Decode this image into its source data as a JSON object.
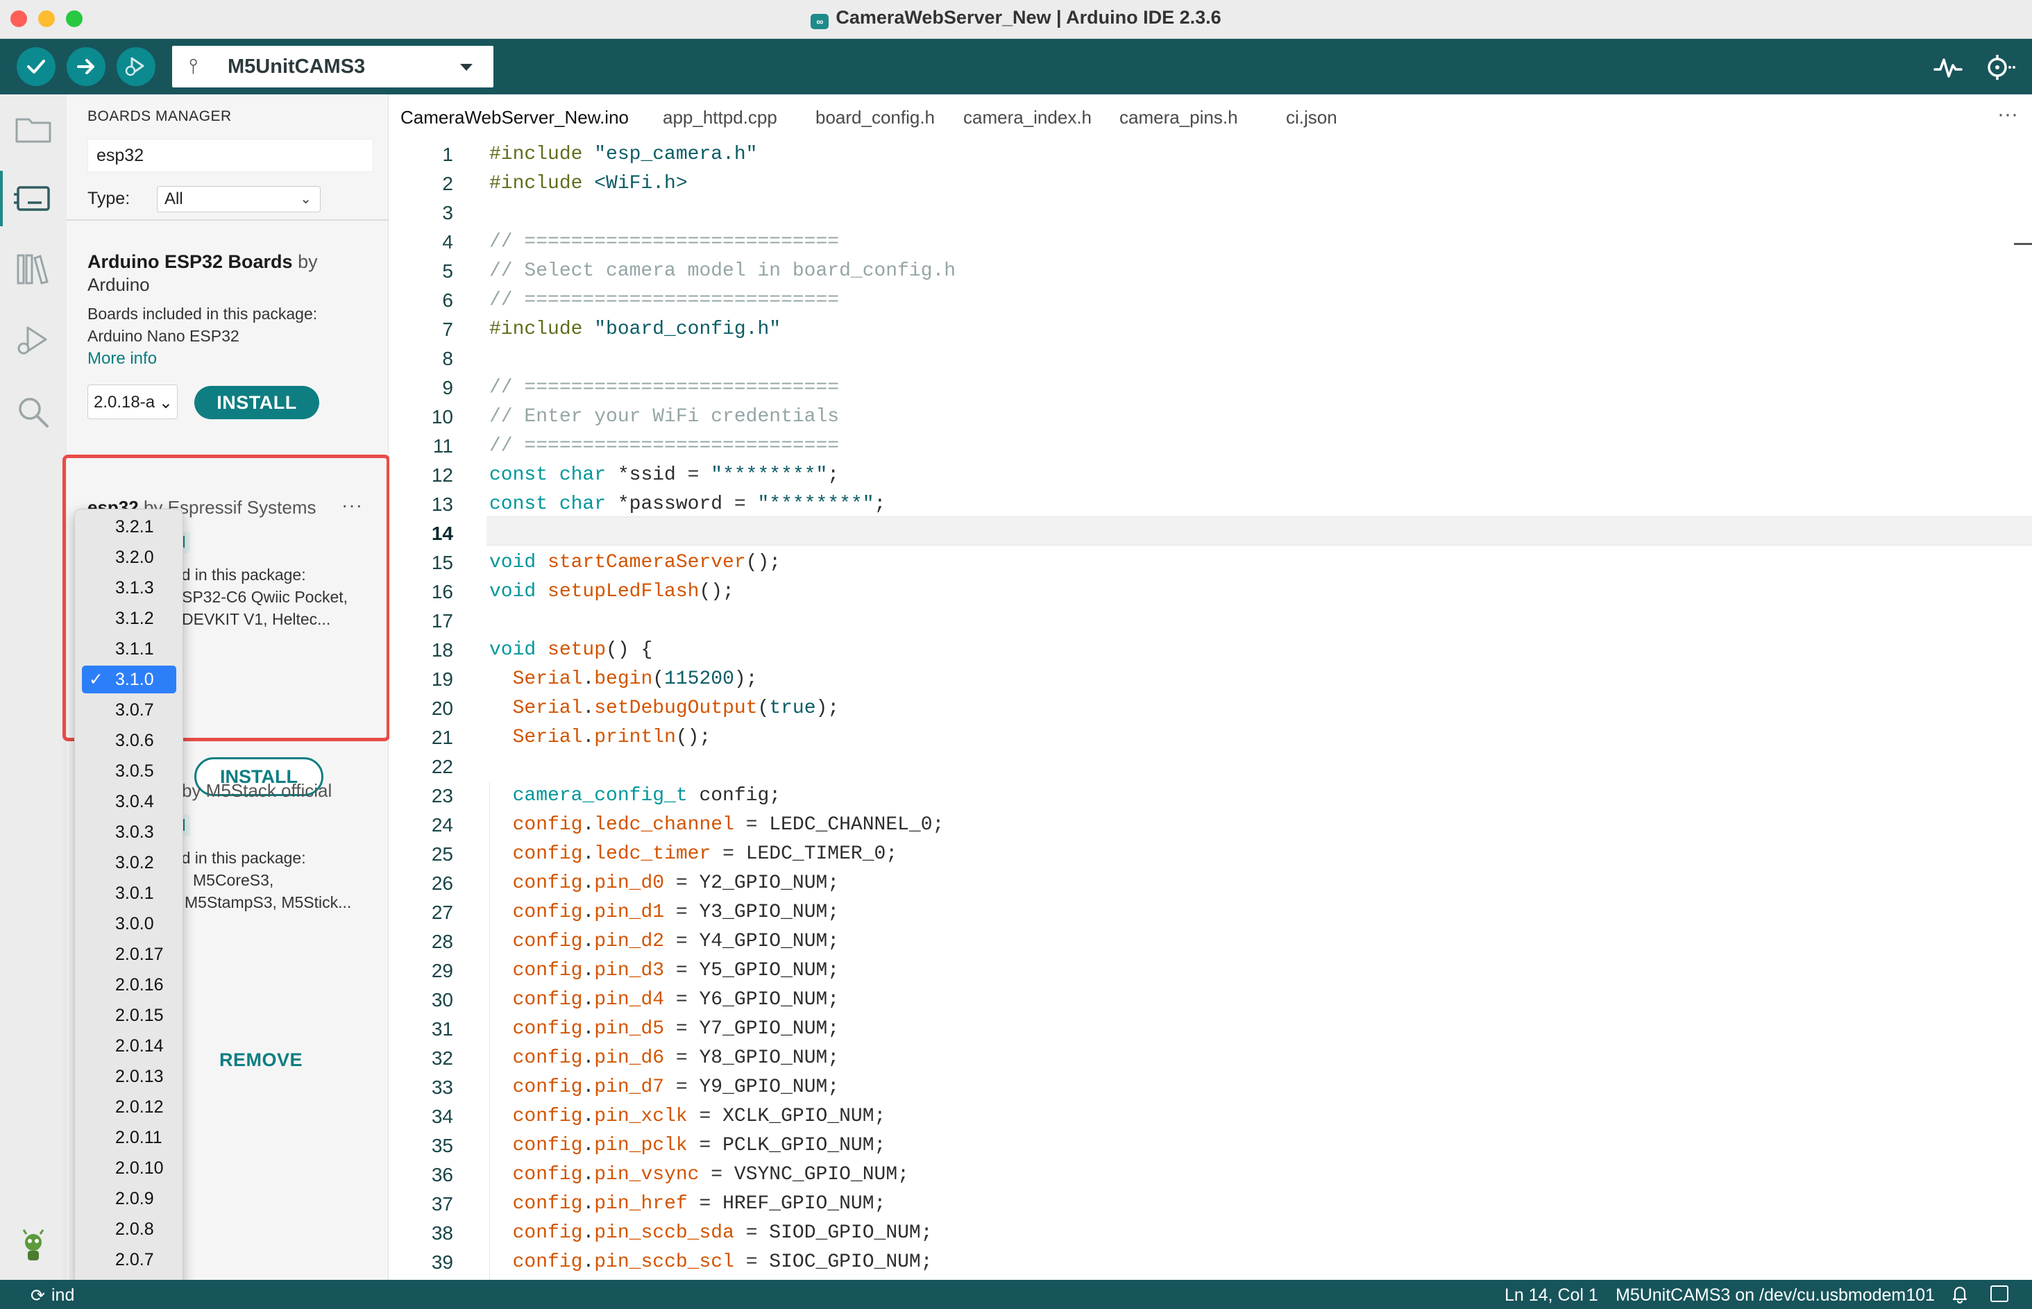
{
  "window": {
    "title": "CameraWebServer_New | Arduino IDE 2.3.6"
  },
  "toolbar": {
    "board": "M5UnitCAMS3",
    "verify_icon": "check-icon",
    "upload_icon": "arrow-right-icon",
    "debug_icon": "debug-icon"
  },
  "boards_manager": {
    "title": "BOARDS MANAGER",
    "search_value": "esp32",
    "type_label": "Type:",
    "type_value": "All",
    "packages": [
      {
        "name": "Arduino ESP32 Boards",
        "by": "by",
        "author": "Arduino",
        "included_label": "Boards included in this package:",
        "boards": "Arduino Nano ESP32",
        "more_info": "More info",
        "version": "2.0.18-a",
        "action": "INSTALL"
      },
      {
        "name": "esp32",
        "by_author": "by Espressif Systems",
        "installed": "ed",
        "included_fragment": "ded in this package:",
        "boards_line1": "SP32-C6 Qwiic Pocket,",
        "boards_line2": "DEVKIT V1, Heltec...",
        "action": "INSTALL"
      },
      {
        "by_author": "by M5Stack official",
        "installed": "ed",
        "included_fragment": "ded in this package:",
        "boards_line1": "M5CoreS3,",
        "boards_line2": "M5StampS3, M5Stick...",
        "action": "REMOVE"
      }
    ]
  },
  "version_dropdown": {
    "selected": "3.1.0",
    "check": "✓",
    "options": [
      "3.2.1",
      "3.2.0",
      "3.1.3",
      "3.1.2",
      "3.1.1",
      "3.1.0",
      "3.0.7",
      "3.0.6",
      "3.0.5",
      "3.0.4",
      "3.0.3",
      "3.0.2",
      "3.0.1",
      "3.0.0",
      "2.0.17",
      "2.0.16",
      "2.0.15",
      "2.0.14",
      "2.0.13",
      "2.0.12",
      "2.0.11",
      "2.0.10",
      "2.0.9",
      "2.0.8",
      "2.0.7"
    ]
  },
  "tabs": [
    "CameraWebServer_New.ino",
    "app_httpd.cpp",
    "board_config.h",
    "camera_index.h",
    "camera_pins.h",
    "ci.json"
  ],
  "editor": {
    "current_line": 14,
    "lines": [
      {
        "n": "1",
        "t": [
          [
            "pp",
            "#include "
          ],
          [
            "str",
            "\"esp_camera.h\""
          ]
        ]
      },
      {
        "n": "2",
        "t": [
          [
            "pp",
            "#include "
          ],
          [
            "str",
            "<WiFi.h>"
          ]
        ]
      },
      {
        "n": "3",
        "t": []
      },
      {
        "n": "4",
        "t": [
          [
            "cmt",
            "// ==========================="
          ]
        ]
      },
      {
        "n": "5",
        "t": [
          [
            "cmt",
            "// Select camera model in board_config.h"
          ]
        ]
      },
      {
        "n": "6",
        "t": [
          [
            "cmt",
            "// ==========================="
          ]
        ]
      },
      {
        "n": "7",
        "t": [
          [
            "pp",
            "#include "
          ],
          [
            "str",
            "\"board_config.h\""
          ]
        ]
      },
      {
        "n": "8",
        "t": []
      },
      {
        "n": "9",
        "t": [
          [
            "cmt",
            "// ==========================="
          ]
        ]
      },
      {
        "n": "10",
        "t": [
          [
            "cmt",
            "// Enter your WiFi credentials"
          ]
        ]
      },
      {
        "n": "11",
        "t": [
          [
            "cmt",
            "// ==========================="
          ]
        ]
      },
      {
        "n": "12",
        "t": [
          [
            "kw",
            "const char "
          ],
          [
            "txt",
            "*ssid = "
          ],
          [
            "str",
            "\"********\""
          ],
          [
            "txt",
            ";"
          ]
        ]
      },
      {
        "n": "13",
        "t": [
          [
            "kw",
            "const char "
          ],
          [
            "txt",
            "*password = "
          ],
          [
            "str",
            "\"********\""
          ],
          [
            "txt",
            ";"
          ]
        ]
      },
      {
        "n": "14",
        "t": []
      },
      {
        "n": "15",
        "t": [
          [
            "kw",
            "void "
          ],
          [
            "fn",
            "startCameraServer"
          ],
          [
            "txt",
            "();"
          ]
        ]
      },
      {
        "n": "16",
        "t": [
          [
            "kw",
            "void "
          ],
          [
            "fn",
            "setupLedFlash"
          ],
          [
            "txt",
            "();"
          ]
        ]
      },
      {
        "n": "17",
        "t": []
      },
      {
        "n": "18",
        "t": [
          [
            "kw",
            "void "
          ],
          [
            "fn",
            "setup"
          ],
          [
            "txt",
            "() {"
          ]
        ]
      },
      {
        "n": "19",
        "t": [
          [
            "txt",
            "  "
          ],
          [
            "fn",
            "Serial"
          ],
          [
            "txt",
            "."
          ],
          [
            "fn",
            "begin"
          ],
          [
            "txt",
            "("
          ],
          [
            "num",
            "115200"
          ],
          [
            "txt",
            ");"
          ]
        ]
      },
      {
        "n": "20",
        "t": [
          [
            "txt",
            "  "
          ],
          [
            "fn",
            "Serial"
          ],
          [
            "txt",
            "."
          ],
          [
            "fn",
            "setDebugOutput"
          ],
          [
            "txt",
            "("
          ],
          [
            "num",
            "true"
          ],
          [
            "txt",
            ");"
          ]
        ]
      },
      {
        "n": "21",
        "t": [
          [
            "txt",
            "  "
          ],
          [
            "fn",
            "Serial"
          ],
          [
            "txt",
            "."
          ],
          [
            "fn",
            "println"
          ],
          [
            "txt",
            "();"
          ]
        ]
      },
      {
        "n": "22",
        "t": []
      },
      {
        "n": "23",
        "t": [
          [
            "txt",
            "  "
          ],
          [
            "kw",
            "camera_config_t "
          ],
          [
            "txt",
            "config;"
          ]
        ]
      },
      {
        "n": "24",
        "t": [
          [
            "txt",
            "  "
          ],
          [
            "fn",
            "config"
          ],
          [
            "txt",
            "."
          ],
          [
            "fn",
            "ledc_channel"
          ],
          [
            "txt",
            " = LEDC_CHANNEL_0;"
          ]
        ]
      },
      {
        "n": "25",
        "t": [
          [
            "txt",
            "  "
          ],
          [
            "fn",
            "config"
          ],
          [
            "txt",
            "."
          ],
          [
            "fn",
            "ledc_timer"
          ],
          [
            "txt",
            " = LEDC_TIMER_0;"
          ]
        ]
      },
      {
        "n": "26",
        "t": [
          [
            "txt",
            "  "
          ],
          [
            "fn",
            "config"
          ],
          [
            "txt",
            "."
          ],
          [
            "fn",
            "pin_d0"
          ],
          [
            "txt",
            " = Y2_GPIO_NUM;"
          ]
        ]
      },
      {
        "n": "27",
        "t": [
          [
            "txt",
            "  "
          ],
          [
            "fn",
            "config"
          ],
          [
            "txt",
            "."
          ],
          [
            "fn",
            "pin_d1"
          ],
          [
            "txt",
            " = Y3_GPIO_NUM;"
          ]
        ]
      },
      {
        "n": "28",
        "t": [
          [
            "txt",
            "  "
          ],
          [
            "fn",
            "config"
          ],
          [
            "txt",
            "."
          ],
          [
            "fn",
            "pin_d2"
          ],
          [
            "txt",
            " = Y4_GPIO_NUM;"
          ]
        ]
      },
      {
        "n": "29",
        "t": [
          [
            "txt",
            "  "
          ],
          [
            "fn",
            "config"
          ],
          [
            "txt",
            "."
          ],
          [
            "fn",
            "pin_d3"
          ],
          [
            "txt",
            " = Y5_GPIO_NUM;"
          ]
        ]
      },
      {
        "n": "30",
        "t": [
          [
            "txt",
            "  "
          ],
          [
            "fn",
            "config"
          ],
          [
            "txt",
            "."
          ],
          [
            "fn",
            "pin_d4"
          ],
          [
            "txt",
            " = Y6_GPIO_NUM;"
          ]
        ]
      },
      {
        "n": "31",
        "t": [
          [
            "txt",
            "  "
          ],
          [
            "fn",
            "config"
          ],
          [
            "txt",
            "."
          ],
          [
            "fn",
            "pin_d5"
          ],
          [
            "txt",
            " = Y7_GPIO_NUM;"
          ]
        ]
      },
      {
        "n": "32",
        "t": [
          [
            "txt",
            "  "
          ],
          [
            "fn",
            "config"
          ],
          [
            "txt",
            "."
          ],
          [
            "fn",
            "pin_d6"
          ],
          [
            "txt",
            " = Y8_GPIO_NUM;"
          ]
        ]
      },
      {
        "n": "33",
        "t": [
          [
            "txt",
            "  "
          ],
          [
            "fn",
            "config"
          ],
          [
            "txt",
            "."
          ],
          [
            "fn",
            "pin_d7"
          ],
          [
            "txt",
            " = Y9_GPIO_NUM;"
          ]
        ]
      },
      {
        "n": "34",
        "t": [
          [
            "txt",
            "  "
          ],
          [
            "fn",
            "config"
          ],
          [
            "txt",
            "."
          ],
          [
            "fn",
            "pin_xclk"
          ],
          [
            "txt",
            " = XCLK_GPIO_NUM;"
          ]
        ]
      },
      {
        "n": "35",
        "t": [
          [
            "txt",
            "  "
          ],
          [
            "fn",
            "config"
          ],
          [
            "txt",
            "."
          ],
          [
            "fn",
            "pin_pclk"
          ],
          [
            "txt",
            " = PCLK_GPIO_NUM;"
          ]
        ]
      },
      {
        "n": "36",
        "t": [
          [
            "txt",
            "  "
          ],
          [
            "fn",
            "config"
          ],
          [
            "txt",
            "."
          ],
          [
            "fn",
            "pin_vsync"
          ],
          [
            "txt",
            " = VSYNC_GPIO_NUM;"
          ]
        ]
      },
      {
        "n": "37",
        "t": [
          [
            "txt",
            "  "
          ],
          [
            "fn",
            "config"
          ],
          [
            "txt",
            "."
          ],
          [
            "fn",
            "pin_href"
          ],
          [
            "txt",
            " = HREF_GPIO_NUM;"
          ]
        ]
      },
      {
        "n": "38",
        "t": [
          [
            "txt",
            "  "
          ],
          [
            "fn",
            "config"
          ],
          [
            "txt",
            "."
          ],
          [
            "fn",
            "pin_sccb_sda"
          ],
          [
            "txt",
            " = SIOD_GPIO_NUM;"
          ]
        ]
      },
      {
        "n": "39",
        "t": [
          [
            "txt",
            "  "
          ],
          [
            "fn",
            "config"
          ],
          [
            "txt",
            "."
          ],
          [
            "fn",
            "pin_sccb_scl"
          ],
          [
            "txt",
            " = SIOC_GPIO_NUM;"
          ]
        ]
      }
    ]
  },
  "status": {
    "indexing": "ind",
    "position": "Ln 14, Col 1",
    "port": "M5UnitCAMS3 on /dev/cu.usbmodem101"
  },
  "colors": {
    "toolbar": "#17555b",
    "accent": "#0e7e82",
    "highlight_box": "#e94c47",
    "dropdown_selected": "#2d7ff9"
  }
}
